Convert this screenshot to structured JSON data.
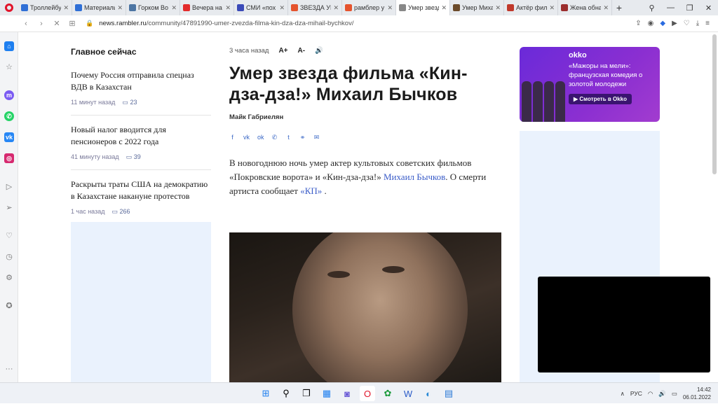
{
  "tabs": [
    {
      "title": "Троллейбус",
      "color": "#2f6fd6"
    },
    {
      "title": "Материалы",
      "color": "#2f6fd6"
    },
    {
      "title": "Горком Во",
      "color": "#4c75a3"
    },
    {
      "title": "Вечера на",
      "color": "#e32b2b"
    },
    {
      "title": "СМИ «пох",
      "color": "#3b4ab8"
    },
    {
      "title": "ЗВЕЗДА УМ",
      "color": "#e5532d"
    },
    {
      "title": "рамблер у",
      "color": "#e5532d"
    },
    {
      "title": "Умер звезд",
      "color": "#888888"
    },
    {
      "title": "Умер Миха",
      "color": "#6b4a2a"
    },
    {
      "title": "Актёр фил",
      "color": "#c0392b"
    },
    {
      "title": "Жена обна",
      "color": "#9b2d2d"
    }
  ],
  "address": {
    "domain": "news.rambler.ru",
    "path": "/community/47891990-umer-zvezda-filma-kin-dza-dza-mihail-bychkov/"
  },
  "left": {
    "heading": "Главное сейчас",
    "items": [
      {
        "title": "Почему Россия отправила спецназ ВДВ в Казахстан",
        "time": "11 минут назад",
        "comments": "23"
      },
      {
        "title": "Новый налог вводится для пенсионеров с 2022 года",
        "time": "41 минуту назад",
        "comments": "39"
      },
      {
        "title": "Раскрыты траты США на демократию в Казахстане накануне протестов",
        "time": "1 час назад",
        "comments": "266"
      }
    ]
  },
  "article": {
    "time": "3 часа назад",
    "font_up": "A+",
    "font_down": "A-",
    "headline": "Умер звезда фильма «Кин-дза-дза!» Михаил Бычков",
    "author": "Майк Габриелян",
    "lead_1": "В новогоднюю ночь умер актер культовых советских фильмов «Покровские ворота» и «Кин-дза-дза!» ",
    "lead_link_1": "Михаил Бычков",
    "lead_2": ". О смерти артиста сообщает ",
    "lead_link_2": "«КП»",
    "lead_3": " ."
  },
  "ad": {
    "logo": "okko",
    "text": "«Мажоры на мели»: французская комедия о золотой молодежи",
    "button": "Смотреть в Okko"
  },
  "taskbar": {
    "lang": "РУС",
    "time": "14:42",
    "date": "06.01.2022"
  }
}
